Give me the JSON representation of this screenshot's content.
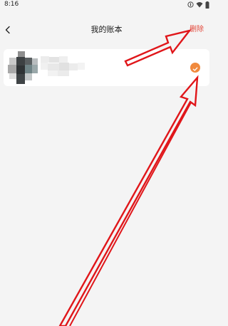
{
  "status_bar": {
    "time": "8:16",
    "icons": [
      "data-icon",
      "wifi-icon",
      "battery-icon"
    ]
  },
  "header": {
    "back_icon": "chevron-left-icon",
    "title": "我的账本",
    "delete_label": "删除"
  },
  "account_list": {
    "items": [
      {
        "avatar": "pixelated-avatar",
        "name_blurred": true,
        "selected": true,
        "selected_icon": "check-icon"
      }
    ]
  },
  "colors": {
    "background": "#f4f4f4",
    "card": "#ffffff",
    "accent_delete": "#e34a3c",
    "check_badge": "#f0893d",
    "annotation_arrows": "#e0161a"
  }
}
